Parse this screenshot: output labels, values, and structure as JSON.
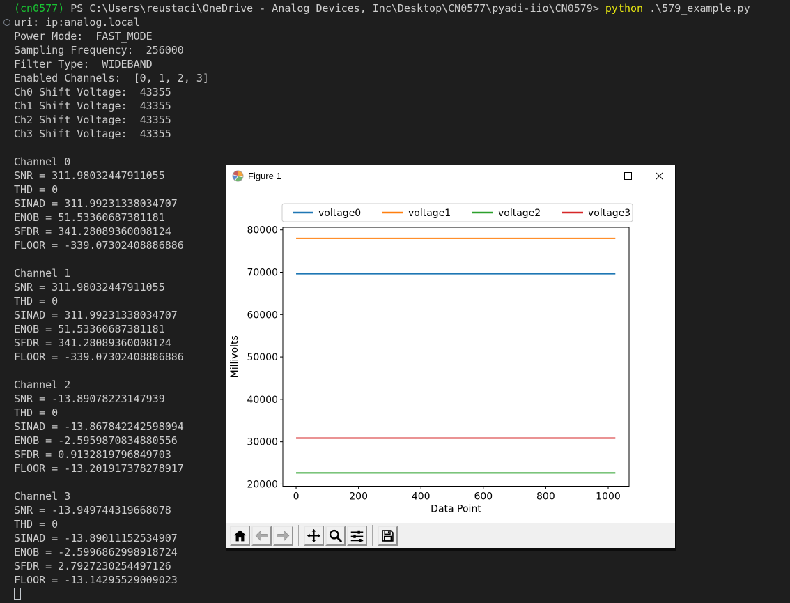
{
  "terminal": {
    "colors": {
      "bg": "#1e1e1e",
      "fg": "#cccccc",
      "green": "#19c332",
      "yellow": "#e5e510"
    },
    "command_decoration_icon": "circle-outline-icon",
    "lines": [
      {
        "segments": [
          {
            "c": "green",
            "t": "(cn0577) "
          },
          {
            "c": "fg",
            "t": "PS C:\\Users\\reustaci\\OneDrive - Analog Devices, Inc\\Desktop\\CN0577\\pyadi-iio\\CN0579> "
          },
          {
            "c": "yellow",
            "t": "python"
          },
          {
            "c": "fg",
            "t": " .\\579_example.py"
          }
        ]
      },
      {
        "decoration": true,
        "segments": [
          {
            "c": "fg",
            "t": "uri: ip:analog.local"
          }
        ]
      },
      {
        "segments": [
          {
            "c": "fg",
            "t": "Power Mode:  FAST_MODE"
          }
        ]
      },
      {
        "segments": [
          {
            "c": "fg",
            "t": "Sampling Frequency:  256000"
          }
        ]
      },
      {
        "segments": [
          {
            "c": "fg",
            "t": "Filter Type:  WIDEBAND"
          }
        ]
      },
      {
        "segments": [
          {
            "c": "fg",
            "t": "Enabled Channels:  [0, 1, 2, 3]"
          }
        ]
      },
      {
        "segments": [
          {
            "c": "fg",
            "t": "Ch0 Shift Voltage:  43355"
          }
        ]
      },
      {
        "segments": [
          {
            "c": "fg",
            "t": "Ch1 Shift Voltage:  43355"
          }
        ]
      },
      {
        "segments": [
          {
            "c": "fg",
            "t": "Ch2 Shift Voltage:  43355"
          }
        ]
      },
      {
        "segments": [
          {
            "c": "fg",
            "t": "Ch3 Shift Voltage:  43355"
          }
        ]
      },
      {
        "segments": []
      },
      {
        "segments": [
          {
            "c": "fg",
            "t": "Channel 0"
          }
        ]
      },
      {
        "segments": [
          {
            "c": "fg",
            "t": "SNR = 311.98032447911055"
          }
        ]
      },
      {
        "segments": [
          {
            "c": "fg",
            "t": "THD = 0"
          }
        ]
      },
      {
        "segments": [
          {
            "c": "fg",
            "t": "SINAD = 311.99231338034707"
          }
        ]
      },
      {
        "segments": [
          {
            "c": "fg",
            "t": "ENOB = 51.53360687381181"
          }
        ]
      },
      {
        "segments": [
          {
            "c": "fg",
            "t": "SFDR = 341.28089360008124"
          }
        ]
      },
      {
        "segments": [
          {
            "c": "fg",
            "t": "FLOOR = -339.07302408886886"
          }
        ]
      },
      {
        "segments": []
      },
      {
        "segments": [
          {
            "c": "fg",
            "t": "Channel 1"
          }
        ]
      },
      {
        "segments": [
          {
            "c": "fg",
            "t": "SNR = 311.98032447911055"
          }
        ]
      },
      {
        "segments": [
          {
            "c": "fg",
            "t": "THD = 0"
          }
        ]
      },
      {
        "segments": [
          {
            "c": "fg",
            "t": "SINAD = 311.99231338034707"
          }
        ]
      },
      {
        "segments": [
          {
            "c": "fg",
            "t": "ENOB = 51.53360687381181"
          }
        ]
      },
      {
        "segments": [
          {
            "c": "fg",
            "t": "SFDR = 341.28089360008124"
          }
        ]
      },
      {
        "segments": [
          {
            "c": "fg",
            "t": "FLOOR = -339.07302408886886"
          }
        ]
      },
      {
        "segments": []
      },
      {
        "segments": [
          {
            "c": "fg",
            "t": "Channel 2"
          }
        ]
      },
      {
        "segments": [
          {
            "c": "fg",
            "t": "SNR = -13.89078223147939"
          }
        ]
      },
      {
        "segments": [
          {
            "c": "fg",
            "t": "THD = 0"
          }
        ]
      },
      {
        "segments": [
          {
            "c": "fg",
            "t": "SINAD = -13.867842242598094"
          }
        ]
      },
      {
        "segments": [
          {
            "c": "fg",
            "t": "ENOB = -2.5959870834880556"
          }
        ]
      },
      {
        "segments": [
          {
            "c": "fg",
            "t": "SFDR = 0.9132819796849703"
          }
        ]
      },
      {
        "segments": [
          {
            "c": "fg",
            "t": "FLOOR = -13.201917378278917"
          }
        ]
      },
      {
        "segments": []
      },
      {
        "segments": [
          {
            "c": "fg",
            "t": "Channel 3"
          }
        ]
      },
      {
        "segments": [
          {
            "c": "fg",
            "t": "SNR = -13.949744319668078"
          }
        ]
      },
      {
        "segments": [
          {
            "c": "fg",
            "t": "THD = 0"
          }
        ]
      },
      {
        "segments": [
          {
            "c": "fg",
            "t": "SINAD = -13.89011152534907"
          }
        ]
      },
      {
        "segments": [
          {
            "c": "fg",
            "t": "ENOB = -2.5996862998918724"
          }
        ]
      },
      {
        "segments": [
          {
            "c": "fg",
            "t": "SFDR = 2.7927230254497126"
          }
        ]
      },
      {
        "segments": [
          {
            "c": "fg",
            "t": "FLOOR = -13.14295529009023"
          }
        ]
      },
      {
        "cursor": true,
        "segments": []
      }
    ]
  },
  "figure_window": {
    "title": "Figure 1",
    "app_icon": "matplotlib-icon",
    "titlebar_icons": [
      "minimize-icon",
      "maximize-icon",
      "close-icon"
    ],
    "toolbar_buttons": [
      {
        "name": "home",
        "icon": "home-icon",
        "enabled": true
      },
      {
        "name": "back",
        "icon": "back-arrow-icon",
        "enabled": false
      },
      {
        "name": "forward",
        "icon": "forward-arrow-icon",
        "enabled": false
      },
      {
        "name": "pan",
        "icon": "pan-arrows-icon",
        "enabled": true
      },
      {
        "name": "zoom-to-rect",
        "icon": "magnifier-icon",
        "enabled": true
      },
      {
        "name": "configure-subplots",
        "icon": "sliders-icon",
        "enabled": true
      },
      {
        "name": "save",
        "icon": "floppy-disk-icon",
        "enabled": true
      }
    ]
  },
  "chart_data": {
    "type": "line",
    "title": "",
    "xlabel": "Data Point",
    "ylabel": "Millivolts",
    "xlim": [
      -42.5,
      1067
    ],
    "ylim": [
      19500,
      80610
    ],
    "xticks": [
      0,
      200,
      400,
      600,
      800,
      1000
    ],
    "yticks": [
      20000,
      30000,
      40000,
      50000,
      60000,
      70000,
      80000
    ],
    "x_range": [
      0,
      1023
    ],
    "grid": false,
    "legend_position": "top-outside",
    "series": [
      {
        "name": "voltage0",
        "color": "#1f77b4",
        "shape": "flat",
        "value": 69650
      },
      {
        "name": "voltage1",
        "color": "#ff7f0e",
        "shape": "flat",
        "value": 78000
      },
      {
        "name": "voltage2",
        "color": "#2ca02c",
        "shape": "flat",
        "value": 22650
      },
      {
        "name": "voltage3",
        "color": "#d62728",
        "shape": "flat",
        "value": 30850
      }
    ]
  }
}
